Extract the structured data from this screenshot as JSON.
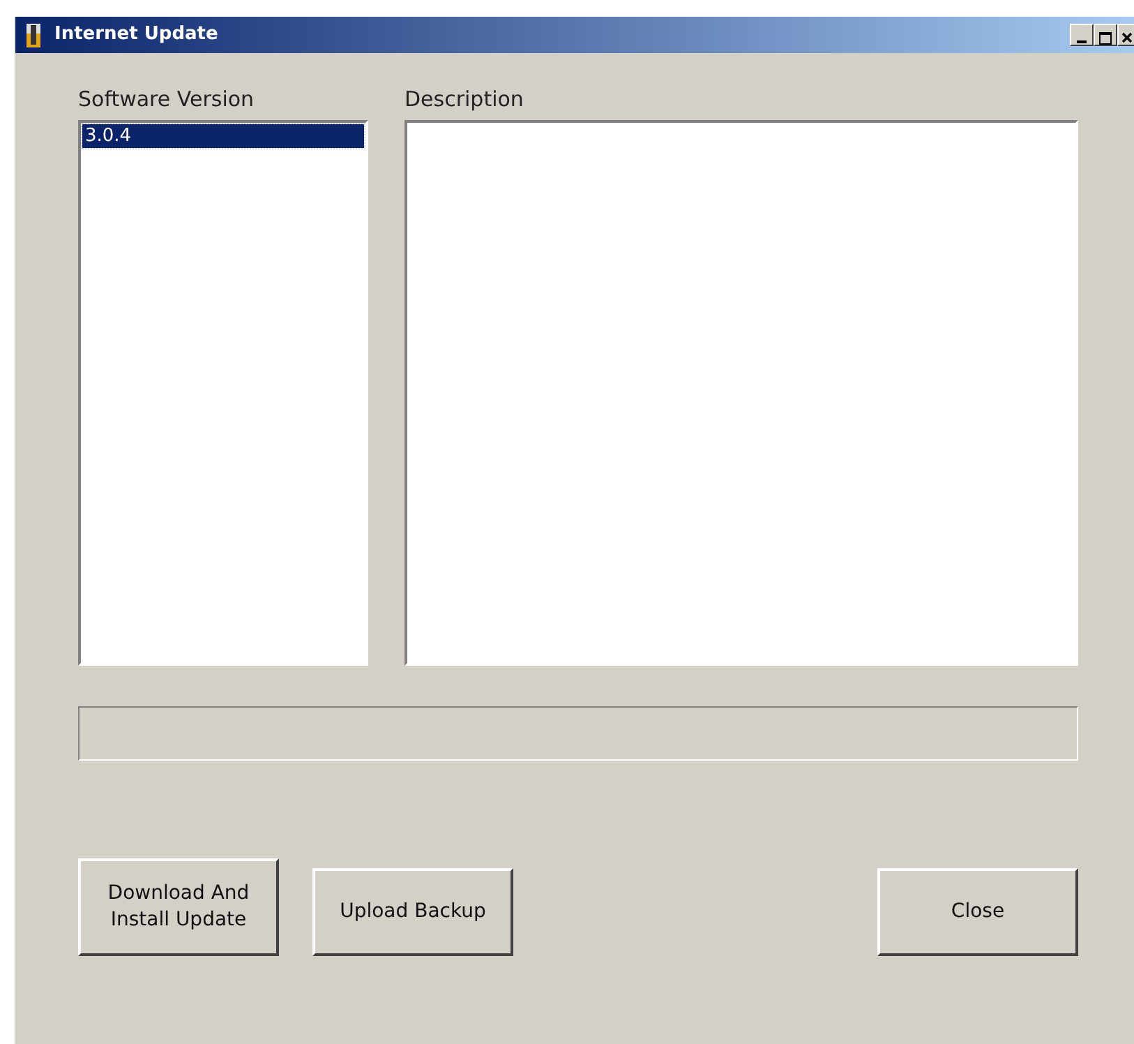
{
  "window": {
    "title": "Internet Update"
  },
  "versions": {
    "label": "Software Version",
    "items": [
      {
        "label": "3.0.4",
        "selected": true
      }
    ]
  },
  "description": {
    "label": "Description"
  },
  "buttons": [
    {
      "label": "Download And\nInstall Update",
      "kind": "action"
    },
    {
      "label": "Upload Backup",
      "kind": "action"
    },
    {
      "label": "Close",
      "kind": "close"
    }
  ]
}
